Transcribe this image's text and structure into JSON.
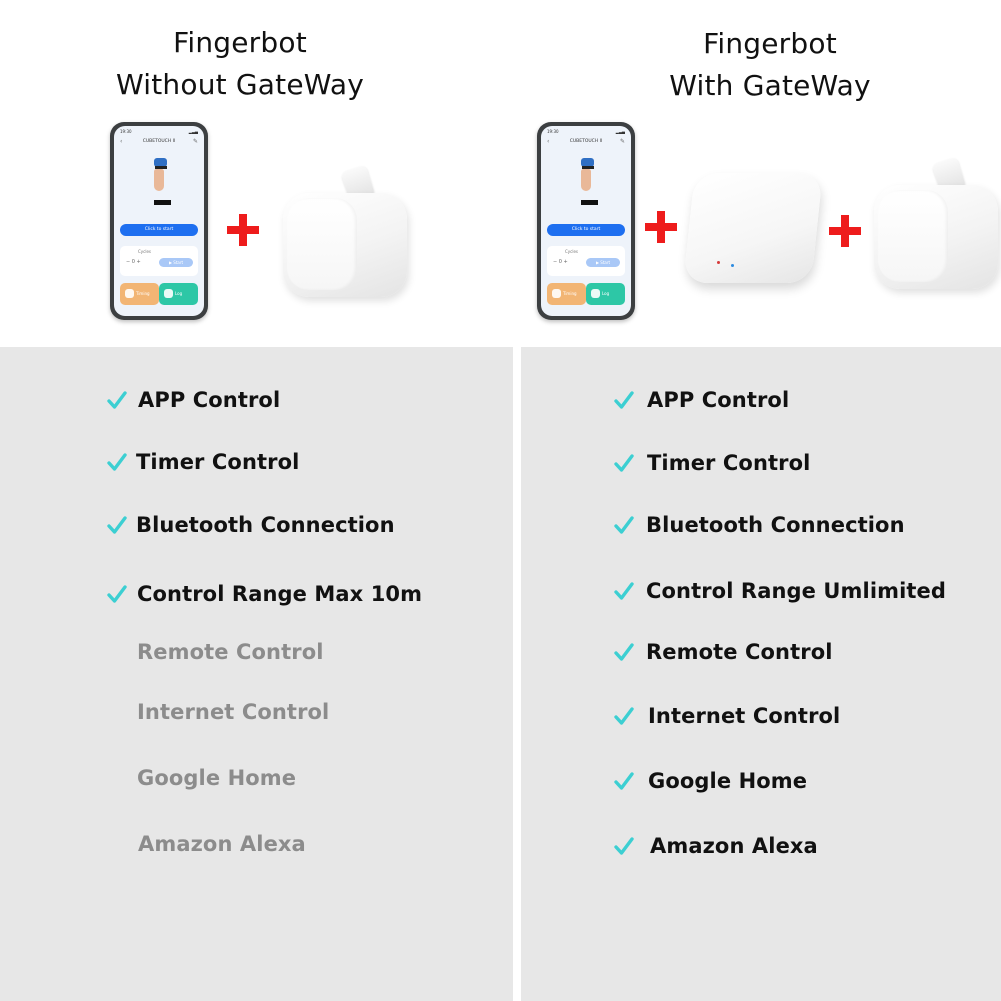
{
  "colors": {
    "check": "#3ccfd2",
    "plus": "#ee1c1c",
    "panel_bg": "#e7e7e7",
    "enabled_text": "#111111",
    "disabled_text": "#8c8c8c",
    "app_primary": "#1e6ff0"
  },
  "left": {
    "title_line1": "Fingerbot",
    "title_line2": "Without GateWay",
    "phone": {
      "status_time": "19:30",
      "status_icons": "▂▃▄",
      "app_title": "CUBETOUCH II",
      "start_button": "Click to start",
      "cycles_label": "Cycles",
      "stepper": "−   0   +",
      "run_button": "▶ Start",
      "tile_timing": "Timing",
      "tile_log": "Log"
    },
    "features": [
      {
        "label": "APP Control",
        "enabled": true
      },
      {
        "label": "Timer Control",
        "enabled": true
      },
      {
        "label": "Bluetooth Connection",
        "enabled": true
      },
      {
        "label": "Control Range Max 10m",
        "enabled": true
      },
      {
        "label": "Remote Control",
        "enabled": false
      },
      {
        "label": "Internet Control",
        "enabled": false
      },
      {
        "label": "Google Home",
        "enabled": false
      },
      {
        "label": "Amazon Alexa",
        "enabled": false
      }
    ]
  },
  "right": {
    "title_line1": "Fingerbot",
    "title_line2": "With GateWay",
    "phone": {
      "status_time": "19:30",
      "status_icons": "▂▃▄",
      "app_title": "CUBETOUCH II",
      "start_button": "Click to start",
      "cycles_label": "Cycles",
      "stepper": "−   0   +",
      "run_button": "▶ Start",
      "tile_timing": "Timing",
      "tile_log": "Log"
    },
    "features": [
      {
        "label": "APP Control",
        "enabled": true
      },
      {
        "label": "Timer Control",
        "enabled": true
      },
      {
        "label": "Bluetooth Connection",
        "enabled": true
      },
      {
        "label": "Control Range Umlimited",
        "enabled": true
      },
      {
        "label": "Remote Control",
        "enabled": true
      },
      {
        "label": "Internet Control",
        "enabled": true
      },
      {
        "label": "Google Home",
        "enabled": true
      },
      {
        "label": "Amazon Alexa",
        "enabled": true
      }
    ]
  }
}
